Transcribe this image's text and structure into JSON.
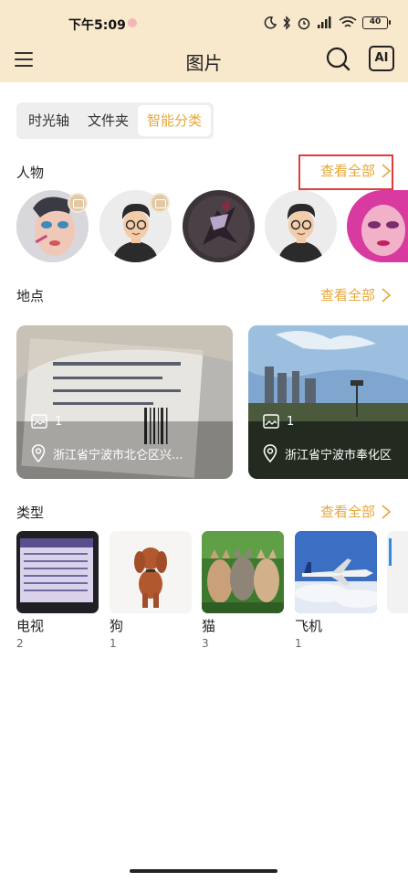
{
  "status_bar": {
    "time": "下午5:09",
    "battery": "40"
  },
  "app_bar": {
    "title": "图片",
    "menu_icon": "menu-icon",
    "search_icon": "search-icon",
    "ai_label": "AI"
  },
  "tabs": [
    {
      "label": "时光轴",
      "active": false
    },
    {
      "label": "文件夹",
      "active": false
    },
    {
      "label": "智能分类",
      "active": true
    }
  ],
  "people": {
    "title": "人物",
    "view_all": "查看全部",
    "avatars": [
      {
        "name": "makeup-woman"
      },
      {
        "name": "cartoon-man"
      },
      {
        "name": "dark-figure"
      },
      {
        "name": "cartoon-man"
      },
      {
        "name": "pink-makeup"
      }
    ]
  },
  "places": {
    "title": "地点",
    "view_all": "查看全部",
    "cards": [
      {
        "count": "1",
        "location": "浙江省宁波市北仑区兴..."
      },
      {
        "count": "1",
        "location": "浙江省宁波市奉化区"
      }
    ]
  },
  "types": {
    "title": "类型",
    "view_all": "查看全部",
    "items": [
      {
        "label": "电视",
        "count": "2"
      },
      {
        "label": "狗",
        "count": "1"
      },
      {
        "label": "猫",
        "count": "3"
      },
      {
        "label": "飞机",
        "count": "1"
      }
    ]
  },
  "colors": {
    "accent": "#e6a73a",
    "topbar": "#f8e8cc",
    "highlight": "#e13b3b"
  }
}
